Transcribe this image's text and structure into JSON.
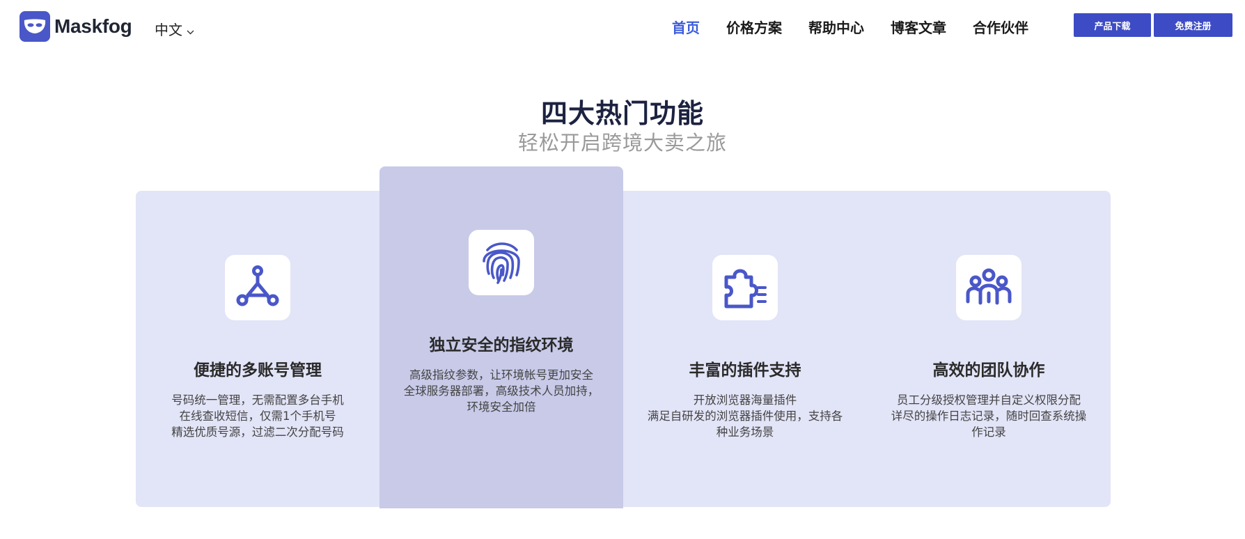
{
  "brand": {
    "name": "Maskfog",
    "accent": "#3d4cc4"
  },
  "language": {
    "current": "中文",
    "icon": "chevron-down-icon"
  },
  "nav": {
    "items": [
      {
        "label": "首页",
        "active": true
      },
      {
        "label": "价格方案"
      },
      {
        "label": "帮助中心"
      },
      {
        "label": "博客文章"
      },
      {
        "label": "合作伙伴"
      }
    ]
  },
  "actions": {
    "download": "产品下载",
    "register": "免费注册"
  },
  "section": {
    "title": "四大热门功能",
    "subtitle": "轻松开启跨境大卖之旅"
  },
  "features": [
    {
      "icon": "network-nodes-icon",
      "title": "便捷的多账号管理",
      "lines": [
        "号码统一管理，无需配置多台手机",
        "在线查收短信，仅需1个手机号",
        "精选优质号源，过滤二次分配号码"
      ]
    },
    {
      "icon": "fingerprint-icon",
      "title": "独立安全的指纹环境",
      "highlighted": true,
      "lines": [
        "高级指纹参数，让环境帐号更加安全",
        "全球服务器部署，高级技术人员加持，",
        "环境安全加倍"
      ]
    },
    {
      "icon": "puzzle-plugin-icon",
      "title": "丰富的插件支持",
      "lines": [
        "开放浏览器海量插件",
        "满足自研发的浏览器插件使用，支持各",
        "种业务场景"
      ]
    },
    {
      "icon": "team-users-icon",
      "title": "高效的团队协作",
      "lines": [
        "员工分级授权管理并自定义权限分配",
        "详尽的操作日志记录，随时回查系统操",
        "作记录"
      ]
    }
  ]
}
